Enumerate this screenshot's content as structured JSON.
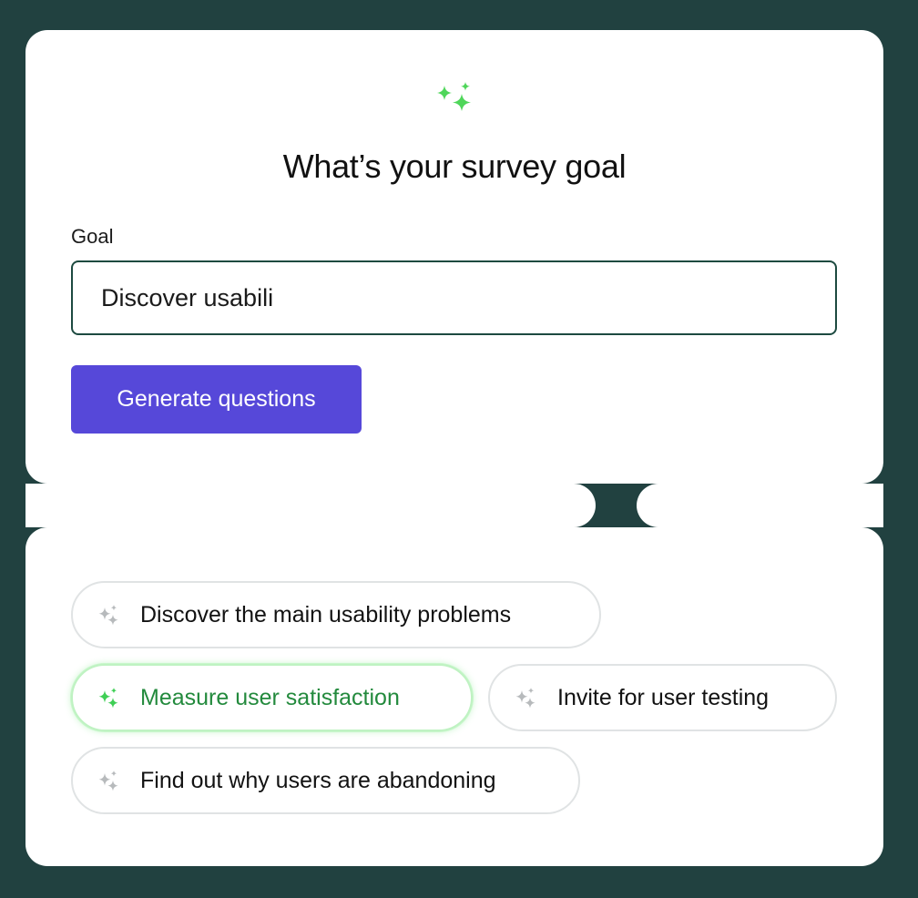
{
  "theme": {
    "background": "#214140",
    "accent": "#5648d9",
    "sparkle_green": "#4fd65a",
    "active_text": "#238a3d"
  },
  "header": {
    "icon": "sparkles-icon",
    "title": "What’s your survey goal"
  },
  "goal": {
    "label": "Goal",
    "value": "Discover usabili"
  },
  "actions": {
    "generate_label": "Generate questions"
  },
  "suggestions": [
    {
      "label": "Discover the main usability problems",
      "icon": "sparkles-icon",
      "active": false
    },
    {
      "label": "Measure user satisfaction",
      "icon": "sparkles-icon",
      "active": true
    },
    {
      "label": "Invite for user testing",
      "icon": "sparkles-icon",
      "active": false
    },
    {
      "label": "Find out why users are abandoning",
      "icon": "sparkles-icon",
      "active": false
    }
  ]
}
